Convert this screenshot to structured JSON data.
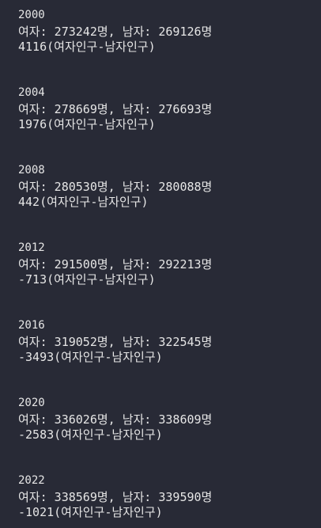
{
  "console": {
    "blocks": [
      {
        "year": "2000",
        "counts": "여자: 273242명, 남자: 269126명",
        "diff": "4116(여자인구-남자인구)"
      },
      {
        "year": "2004",
        "counts": "여자: 278669명, 남자: 276693명",
        "diff": "1976(여자인구-남자인구)"
      },
      {
        "year": "2008",
        "counts": "여자: 280530명, 남자: 280088명",
        "diff": "442(여자인구-남자인구)"
      },
      {
        "year": "2012",
        "counts": "여자: 291500명, 남자: 292213명",
        "diff": "-713(여자인구-남자인구)"
      },
      {
        "year": "2016",
        "counts": "여자: 319052명, 남자: 322545명",
        "diff": "-3493(여자인구-남자인구)"
      },
      {
        "year": "2020",
        "counts": "여자: 336026명, 남자: 338609명",
        "diff": "-2583(여자인구-남자인구)"
      },
      {
        "year": "2022",
        "counts": "여자: 338569명, 남자: 339590명",
        "diff": "-1021(여자인구-남자인구)"
      }
    ]
  },
  "colors": {
    "background": "#282a36",
    "text": "#e6e6e6"
  }
}
